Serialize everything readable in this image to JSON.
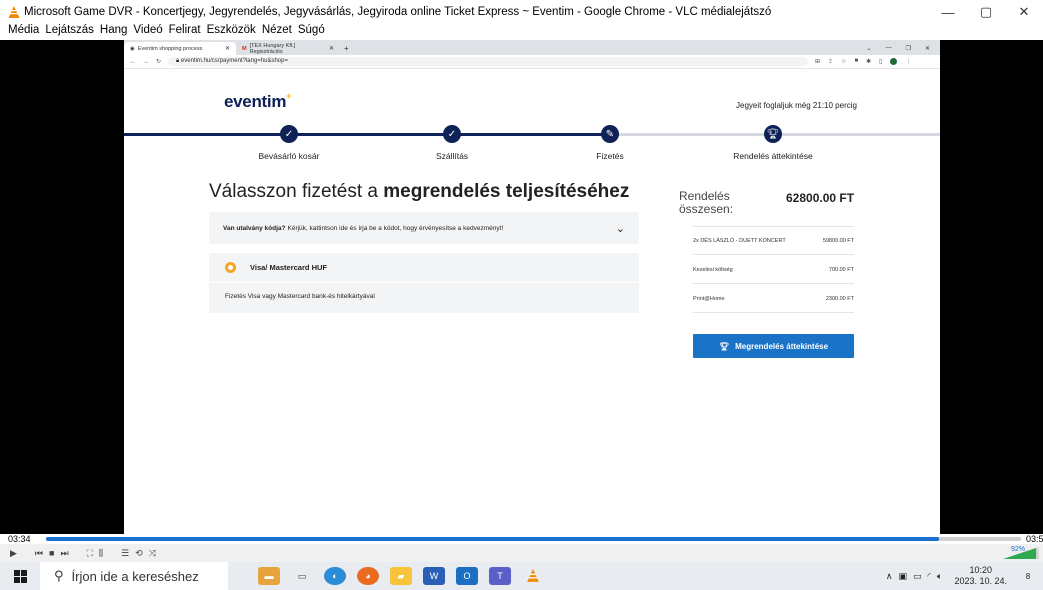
{
  "vlc": {
    "title": "Microsoft Game DVR - Koncertjegy, Jegyrendelés, Jegyvásárlás, Jegyiroda online Ticket Express ~ Eventim - Google Chrome - VLC médialejátszó",
    "menu": [
      "Média",
      "Lejátszás",
      "Hang",
      "Videó",
      "Felirat",
      "Eszközök",
      "Nézet",
      "Súgó"
    ],
    "window_controls": [
      "—",
      "▢",
      "✕"
    ],
    "time_current": "03:34",
    "time_end": "03:5",
    "seek_progress": 0.916,
    "volume_label": "92%"
  },
  "browser": {
    "tabs": [
      {
        "label": "Eventim shopping process",
        "active": true
      },
      {
        "label": "[TEX Hungary Kft.] Regisztrációs",
        "active": false
      }
    ],
    "url": "eventim.hu/cs/payment?lang=hu&shop="
  },
  "page": {
    "brand": "eventim",
    "brand_star": "+",
    "timer_text": "Jegyeit foglaljuk még 21:10 percig",
    "steps": [
      {
        "label": "Bevásárló kosár",
        "icon": "check-icon"
      },
      {
        "label": "Szállítás",
        "icon": "check-icon"
      },
      {
        "label": "Fizetés",
        "icon": "pen-icon"
      },
      {
        "label": "Rendelés áttekintése",
        "icon": "trophy-icon"
      }
    ],
    "headline_regular": "Válasszon fizetést a ",
    "headline_bold": "megrendelés teljesítéséhez",
    "voucher_bold": "Van utalvány kódja?",
    "voucher_text": "Kérjük, kattintson ide és írja be a kódot, hogy érvényesítse a kedvezményt!",
    "payment_method": "Visa/ Mastercard HUF",
    "payment_description": "Fizetés Visa vagy Mastercard bank-és hitelkártyával",
    "summary": {
      "total_label": "Rendelés összesen:",
      "total_value": "62800.00 FT",
      "rows": [
        {
          "label": "2x DÉS LÁSZLÓ - DUETT KONCERT",
          "value": "59800.00 FT"
        },
        {
          "label": "Kezelési költség",
          "value": "700.00 FT"
        },
        {
          "label": "Print@Home",
          "value": "2300.00 FT"
        }
      ],
      "cta_label": "Megrendelés áttekintése"
    }
  },
  "taskbar": {
    "search_placeholder": "Írjon ide a kereséshez",
    "time": "10:20",
    "date": "2023. 10. 24.",
    "notification_count": "8"
  },
  "colors": {
    "brand_navy": "#0f2257",
    "accent_blue": "#1a73c7",
    "radio_orange": "#f5a623",
    "star_yellow": "#f5b324"
  }
}
